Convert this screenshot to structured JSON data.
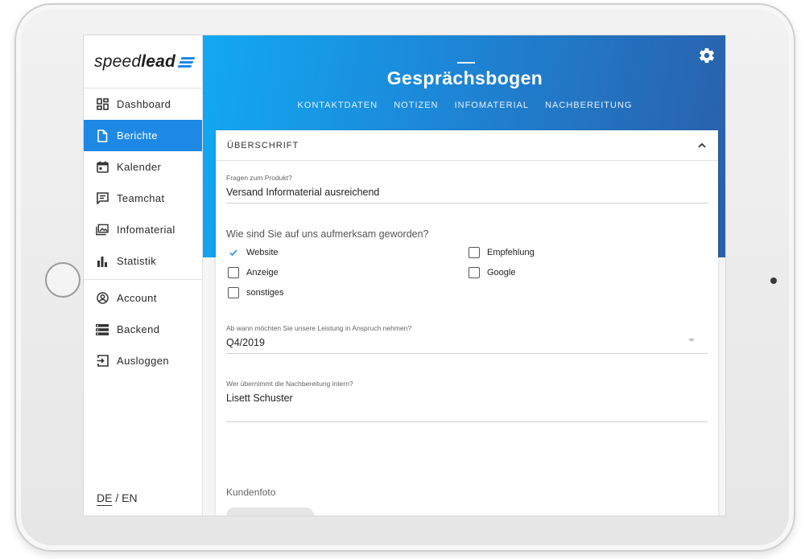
{
  "brand": {
    "name_light": "speed",
    "name_bold": "lead",
    "accent": "#1e88e5"
  },
  "sidebar": {
    "items": [
      {
        "label": "Dashboard",
        "icon": "dashboard-icon",
        "active": false
      },
      {
        "label": "Berichte",
        "icon": "document-icon",
        "active": true
      },
      {
        "label": "Kalender",
        "icon": "calendar-icon",
        "active": false
      },
      {
        "label": "Teamchat",
        "icon": "chat-icon",
        "active": false
      },
      {
        "label": "Infomaterial",
        "icon": "photo-library-icon",
        "active": false
      },
      {
        "label": "Statistik",
        "icon": "bar-chart-icon",
        "active": false
      }
    ],
    "items2": [
      {
        "label": "Account",
        "icon": "account-icon"
      },
      {
        "label": "Backend",
        "icon": "backend-icon"
      },
      {
        "label": "Ausloggen",
        "icon": "logout-icon"
      }
    ],
    "lang": {
      "current": "DE",
      "sep": "/",
      "other": "EN"
    }
  },
  "header": {
    "title": "Gesprächsbogen",
    "tabs": [
      "KONTAKTDATEN",
      "NOTIZEN",
      "INFOMATERIAL",
      "NACHBEREITUNG"
    ],
    "gradient_start": "#12a9f3",
    "gradient_end": "#2a5faa"
  },
  "card": {
    "heading": "ÜBERSCHRIFT",
    "product_question": {
      "label": "Fragen zum Produkt?",
      "value": "Versand Informaterial ausreichend"
    },
    "source_question": "Wie sind Sie auf uns aufmerksam geworden?",
    "checkboxes": [
      {
        "label": "Website",
        "checked": true
      },
      {
        "label": "Anzeige",
        "checked": false
      },
      {
        "label": "sonstiges",
        "checked": false
      },
      {
        "label": "Empfehlung",
        "checked": false
      },
      {
        "label": "Google",
        "checked": false
      }
    ],
    "start_question": {
      "label": "Ab wann möchten Sie unsere Leistung in Anspruch nehmen?",
      "value": "Q4/2019"
    },
    "followup_question": {
      "label": "Wer übernimmt die Nachbereitung intern?",
      "value": "Lisett Schuster"
    },
    "photo_label": "Kundenfoto"
  }
}
